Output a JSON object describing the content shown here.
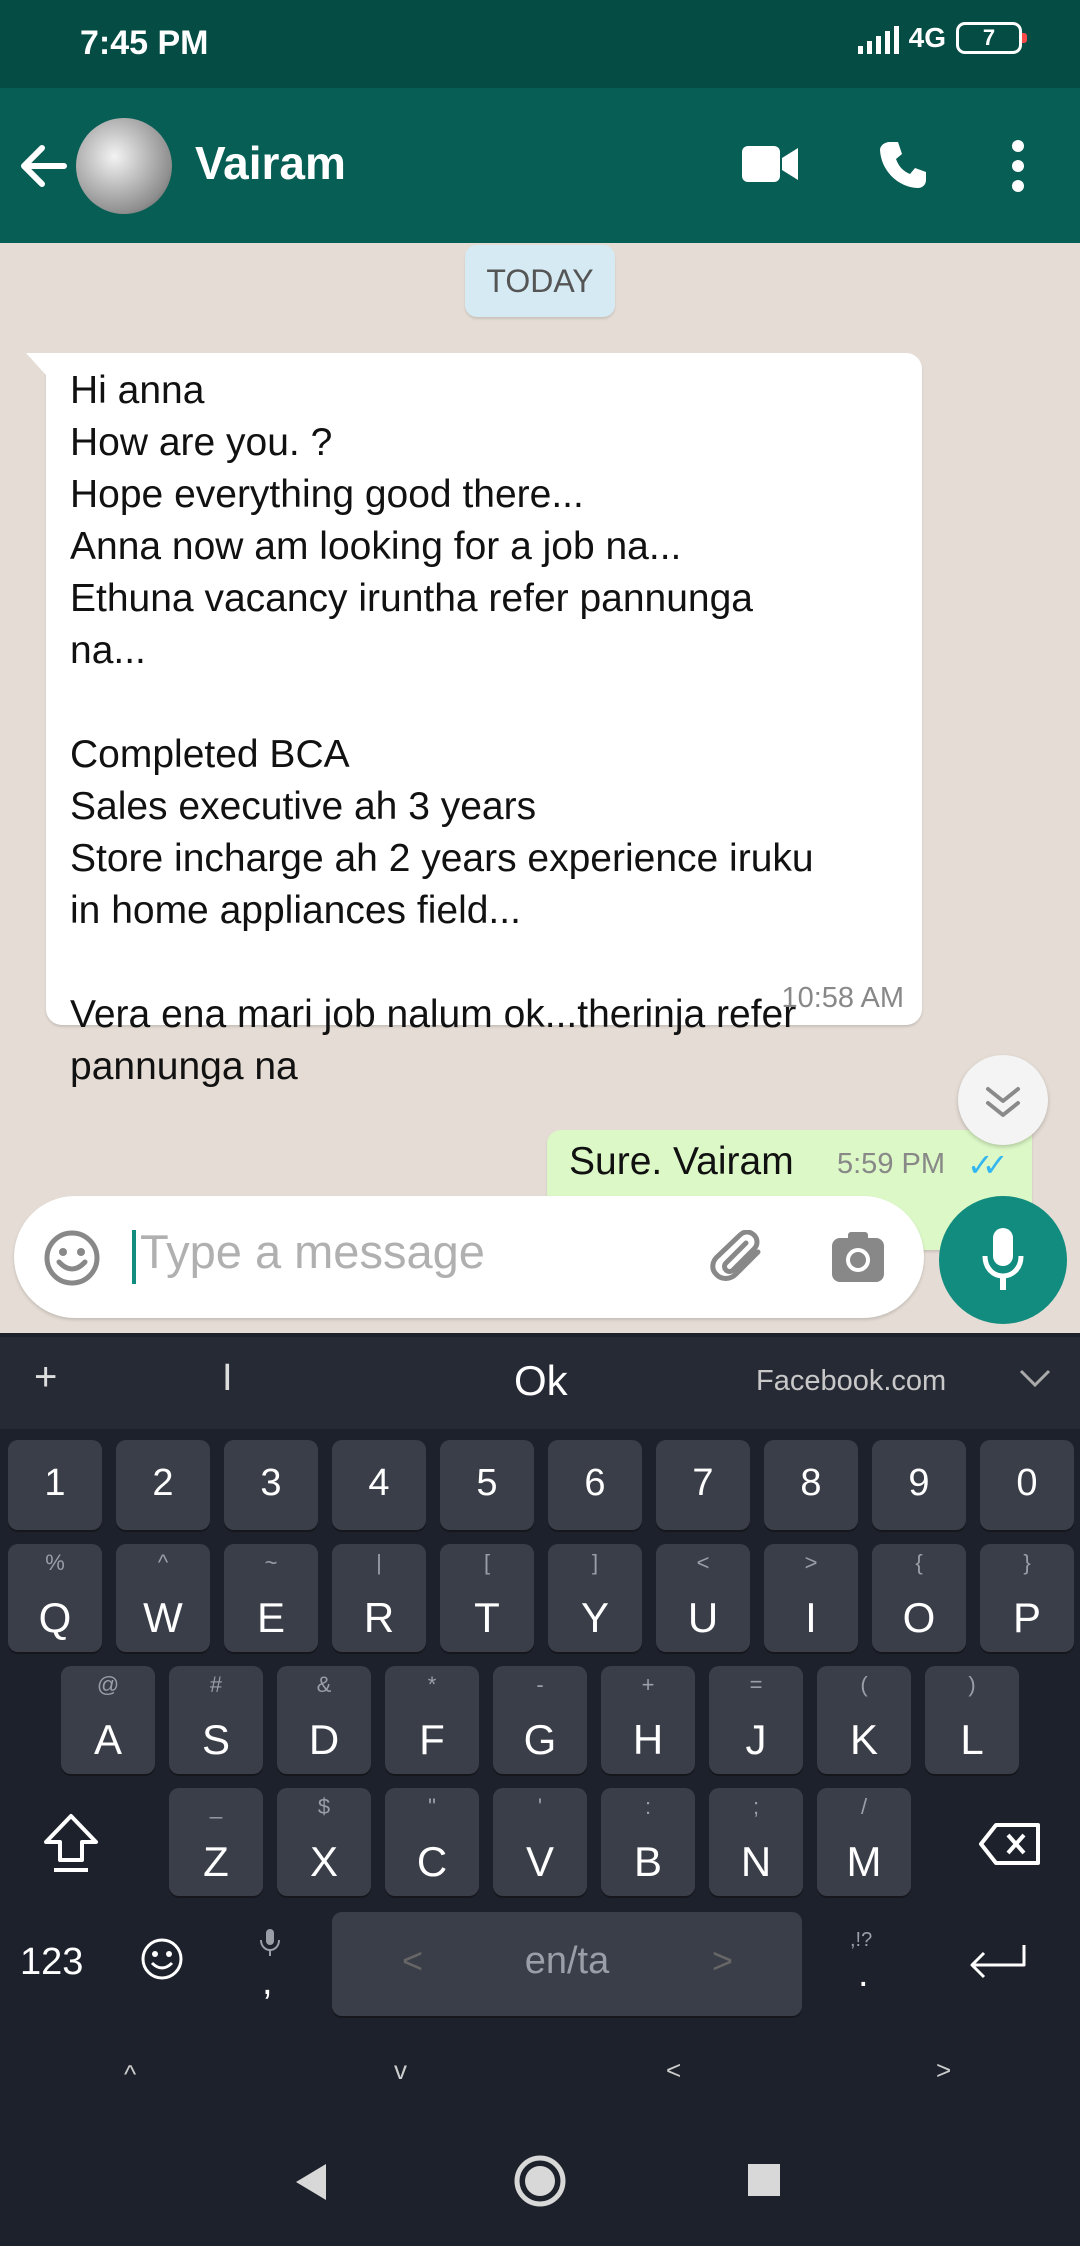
{
  "status": {
    "time": "7:45 PM",
    "network": "4G",
    "battery": "7"
  },
  "header": {
    "contact_name": "Vairam"
  },
  "chat": {
    "date_chip": "TODAY",
    "incoming": {
      "text": "Hi anna\nHow are you. ?\nHope everything good there...\nAnna now am looking for a job na...\nEthuna vacancy iruntha refer pannunga\nna...\n\nCompleted BCA\nSales executive ah 3 years\nStore incharge ah 2 years experience iruku\nin home appliances field...\n\nVera ena mari job nalum ok...therinja refer\npannunga na",
      "time": "10:58 AM"
    },
    "outgoing": {
      "text": "Sure. Vairam",
      "time": "5:59 PM"
    }
  },
  "composer": {
    "placeholder": "Type a message"
  },
  "keyboard": {
    "suggestions": {
      "plus": "+",
      "s1": "I",
      "s2": "Ok",
      "s3": "Facebook.com"
    },
    "numbers": [
      "1",
      "2",
      "3",
      "4",
      "5",
      "6",
      "7",
      "8",
      "9",
      "0"
    ],
    "row1": [
      {
        "main": "Q",
        "sub": "%"
      },
      {
        "main": "W",
        "sub": "^"
      },
      {
        "main": "E",
        "sub": "~"
      },
      {
        "main": "R",
        "sub": "|"
      },
      {
        "main": "T",
        "sub": "["
      },
      {
        "main": "Y",
        "sub": "]"
      },
      {
        "main": "U",
        "sub": "<"
      },
      {
        "main": "I",
        "sub": ">"
      },
      {
        "main": "O",
        "sub": "{"
      },
      {
        "main": "P",
        "sub": "}"
      }
    ],
    "row2": [
      {
        "main": "A",
        "sub": "@"
      },
      {
        "main": "S",
        "sub": "#"
      },
      {
        "main": "D",
        "sub": "&"
      },
      {
        "main": "F",
        "sub": "*"
      },
      {
        "main": "G",
        "sub": "-"
      },
      {
        "main": "H",
        "sub": "+"
      },
      {
        "main": "J",
        "sub": "="
      },
      {
        "main": "K",
        "sub": "("
      },
      {
        "main": "L",
        "sub": ")"
      }
    ],
    "row3": [
      {
        "main": "Z",
        "sub": "_"
      },
      {
        "main": "X",
        "sub": "$"
      },
      {
        "main": "C",
        "sub": "\""
      },
      {
        "main": "V",
        "sub": "'"
      },
      {
        "main": "B",
        "sub": ":"
      },
      {
        "main": "N",
        "sub": ";"
      },
      {
        "main": "M",
        "sub": "/"
      }
    ],
    "bottom": {
      "numbers": "123",
      "comma": ",",
      "space": "en/ta",
      "space_left": "<",
      "space_right": ">",
      "period": ".",
      "period_sub": ",!?"
    },
    "arrows": [
      "^",
      "v",
      "<",
      ">"
    ]
  }
}
